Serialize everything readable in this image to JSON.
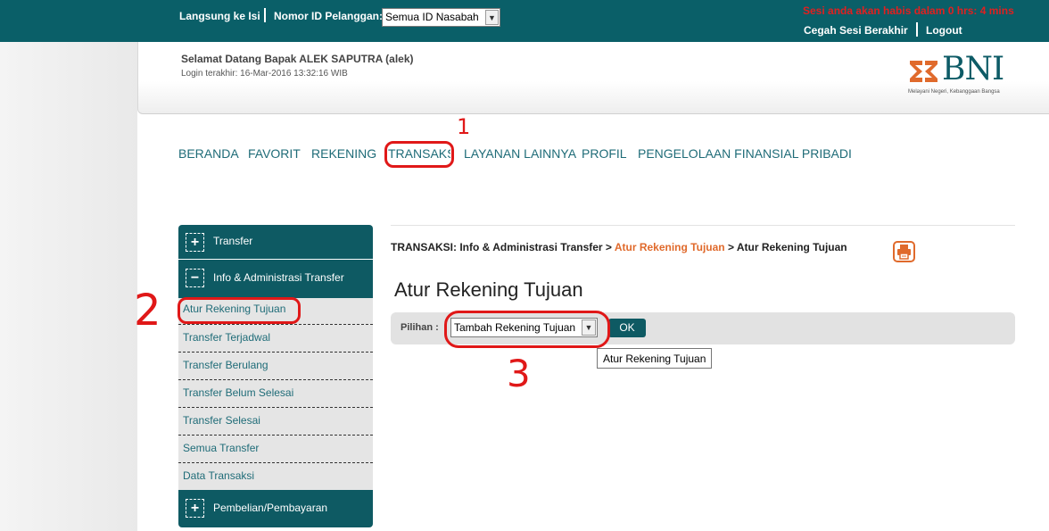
{
  "topbar": {
    "quick_access": "Langsung ke Isi",
    "customer_id_label": "Nomor ID Pelanggan:",
    "customer_id_value": "Semua ID Nasabah",
    "session_warning": "Sesi anda akan habis dalam 0 hrs: 4 mins",
    "prevent_logout": "Cegah Sesi Berakhir",
    "logout": "Logout"
  },
  "header": {
    "welcome": "Selamat Datang Bapak  ALEK  SAPUTRA  (alek)",
    "last_login": "Login terakhir:   16-Mar-2016 13:32:16  WIB",
    "logo_text": "BNI",
    "logo_tagline": "Melayani Negeri, Kebanggaan Bangsa"
  },
  "nav": {
    "items": [
      "BERANDA",
      "FAVORIT",
      "REKENING",
      "TRANSAKSI",
      "LAYANAN LAINNYA",
      "PROFIL",
      "PENGELOLAAN FINANSIAL PRIBADI"
    ]
  },
  "sidebar": {
    "sections": [
      {
        "label": "Transfer",
        "toggle": "+"
      },
      {
        "label": "Info & Administrasi Transfer",
        "toggle": "−"
      },
      {
        "label": "Pembelian/Pembayaran",
        "toggle": "+"
      }
    ],
    "items": [
      "Atur Rekening Tujuan",
      "Transfer Terjadwal",
      "Transfer Berulang",
      "Transfer Belum Selesai",
      "Transfer Selesai",
      "Semua Transfer",
      "Data Transaksi"
    ]
  },
  "main": {
    "breadcrumb_prefix": "TRANSAKSI: Info & Administrasi Transfer > ",
    "breadcrumb_link": "Atur Rekening Tujuan",
    "breadcrumb_current": " > Atur Rekening Tujuan",
    "title": "Atur Rekening Tujuan",
    "option_label": "Pilihan :",
    "option_value": "Tambah Rekening Tujuan",
    "ok_button": "OK",
    "tooltip": "Atur Rekening Tujuan"
  },
  "annotations": [
    "1",
    "2",
    "3"
  ],
  "colors": {
    "primary_teal": "#0a5f68",
    "link_teal": "#1f6c78",
    "accent_orange": "#e06a2c",
    "annotation_red": "#e01818"
  }
}
